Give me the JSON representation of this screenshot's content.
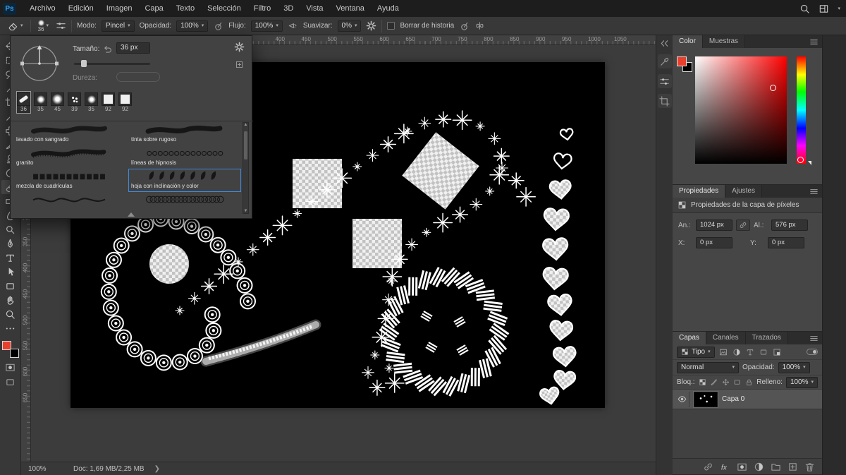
{
  "colors": {
    "accent_blue": "#3f8ae0",
    "foreground_red": "#e8402d"
  },
  "menubar": {
    "logo": "Ps",
    "items": [
      "Archivo",
      "Edición",
      "Imagen",
      "Capa",
      "Texto",
      "Selección",
      "Filtro",
      "3D",
      "Vista",
      "Ventana",
      "Ayuda"
    ]
  },
  "options_bar": {
    "brush_size": "36",
    "modo_label": "Modo:",
    "modo_value": "Pincel",
    "opacidad_label": "Opacidad:",
    "opacidad_value": "100%",
    "flujo_label": "Flujo:",
    "flujo_value": "100%",
    "suavizar_label": "Suavizar:",
    "suavizar_value": "0%",
    "borrar_historia_label": "Borrar de historia"
  },
  "toolbar": {
    "tools": [
      "move",
      "marquee",
      "lasso",
      "magic-wand",
      "crop",
      "eyedropper",
      "healing",
      "brush",
      "clone-stamp",
      "history-brush",
      "eraser",
      "gradient",
      "blur",
      "dodge",
      "pen",
      "type",
      "path-selection",
      "shape",
      "hand",
      "zoom",
      "more-tools"
    ],
    "active_tool": "eraser"
  },
  "brush_picker": {
    "tamano_label": "Tamaño:",
    "tamano_value": "36 px",
    "dureza_label": "Dureza:",
    "tips": [
      {
        "size": "36",
        "shape": "flat",
        "selected": true
      },
      {
        "size": "35",
        "shape": "soft",
        "selected": false
      },
      {
        "size": "45",
        "shape": "soft-big",
        "selected": false
      },
      {
        "size": "39",
        "shape": "spatter",
        "selected": false
      },
      {
        "size": "35",
        "shape": "soft",
        "selected": false
      },
      {
        "size": "92",
        "shape": "square",
        "selected": false
      },
      {
        "size": "92",
        "shape": "square",
        "selected": false
      }
    ],
    "brushes": [
      {
        "name": "lavado con sangrado",
        "style": "taper",
        "selected": false
      },
      {
        "name": "tinta sobre rugoso",
        "style": "rough",
        "selected": false
      },
      {
        "name": "granito",
        "style": "speckle",
        "selected": false
      },
      {
        "name": "líneas de hipnosis",
        "style": "loops",
        "selected": false
      },
      {
        "name": "mezcla de cuadrículas",
        "style": "squares",
        "selected": false
      },
      {
        "name": "hoja con inclinación y color",
        "style": "leaves",
        "selected": true
      },
      {
        "name": "",
        "style": "wave",
        "selected": false
      },
      {
        "name": "",
        "style": "coil",
        "selected": false
      }
    ]
  },
  "rulers": {
    "scale": 0.739,
    "top": [
      400,
      450,
      500,
      550,
      600,
      650,
      700,
      750,
      800,
      850,
      900,
      950,
      1000,
      1050
    ],
    "left": [
      300,
      350,
      400,
      450,
      500,
      550,
      600,
      650
    ]
  },
  "color_panel": {
    "tabs": [
      "Color",
      "Muestras"
    ],
    "active_tab": "Color"
  },
  "properties_panel": {
    "tabs": [
      "Propiedades",
      "Ajustes"
    ],
    "active_tab": "Propiedades",
    "header": "Propiedades de la capa de píxeles",
    "width_label": "An.:",
    "width_value": "1024 px",
    "height_label": "Al.:",
    "height_value": "576 px",
    "x_label": "X:",
    "x_value": "0 px",
    "y_label": "Y:",
    "y_value": "0 px"
  },
  "layers_panel": {
    "tabs": [
      "Capas",
      "Canales",
      "Trazados"
    ],
    "active_tab": "Capas",
    "filter_label": "Tipo",
    "blend_mode": "Normal",
    "opacidad_label": "Opacidad:",
    "opacidad_value": "100%",
    "lock_label": "Bloq.:",
    "relleno_label": "Relleno:",
    "relleno_value": "100%",
    "layers": [
      {
        "name": "Capa 0",
        "visible": true
      }
    ]
  },
  "status_bar": {
    "zoom": "100%",
    "doc_info": "Doc: 1,69 MB/2,25 MB"
  }
}
